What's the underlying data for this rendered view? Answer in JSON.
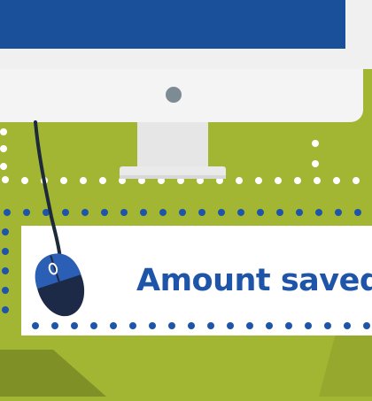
{
  "banner": {
    "label": "Amount saved"
  },
  "colors": {
    "background": "#a3b634",
    "screen_blue": "#1a4f9a",
    "monitor_body": "#f4f4f4",
    "power_dot": "#7d8b94",
    "dots_white": "#ffffff",
    "dots_blue": "#1e55a8",
    "mouse_body": "#1c2a48",
    "mouse_button": "#2a5fb5",
    "cable": "#1c2a3a",
    "text_blue": "#1e55a8",
    "shadow": "#7f9026"
  }
}
